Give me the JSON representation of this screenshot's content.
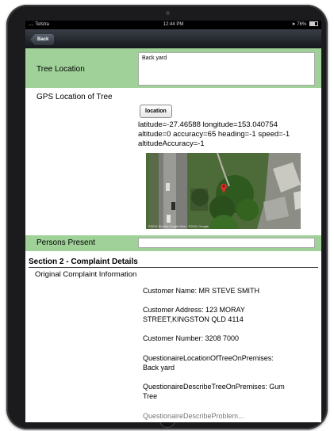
{
  "status": {
    "carrier": ".... Telstra",
    "time": "12:44 PM",
    "battery": "76%"
  },
  "nav": {
    "back_label": "Back"
  },
  "tree_location": {
    "label": "Tree Location",
    "value": "Back yard"
  },
  "gps": {
    "label": "GPS Location of Tree",
    "button_label": "location",
    "line1": "latitude=-27.46588 longitude=153.040754",
    "line2": "altitude=0 accuracy=65 heading=-1 speed=-1",
    "line3": "altitudeAccuracy=-1",
    "map_credit": "©2011 Sinclair Knight Merz, ©2011 Google"
  },
  "persons_present": {
    "label": "Persons Present",
    "value": ""
  },
  "section2": {
    "title": "Section 2 - Complaint Details",
    "subtitle": "Original Complaint Information",
    "customer_name": "Customer Name:  MR STEVE SMITH",
    "customer_address_1": "Customer Address: 123 MORAY",
    "customer_address_2": "STREET,KINGSTON  QLD  4114",
    "customer_number": "Customer Number: 3208 7000",
    "q_location_1": "QuestionaireLocationOfTreeOnPremises:",
    "q_location_2": "Back yard",
    "q_describe_1": "QuestionaireDescribeTreeOnPremises: Gum",
    "q_describe_2": "Tree",
    "q_partial": "QuestionaireDescribeProblem..."
  },
  "colors": {
    "row_green": "#9fd199",
    "nav_dark": "#15181d",
    "map_marker": "#d93025"
  }
}
